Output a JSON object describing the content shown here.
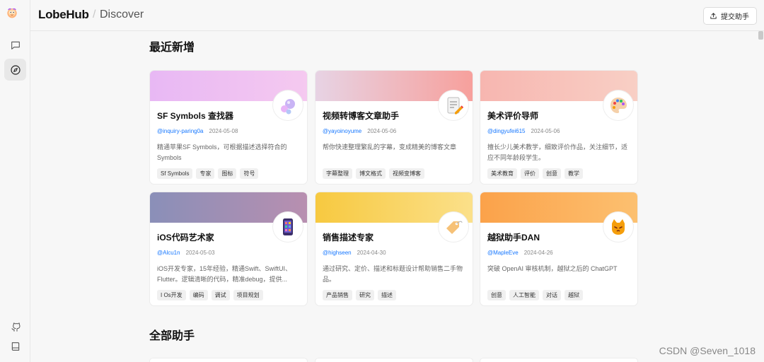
{
  "header": {
    "brand": "LobeHub",
    "separator": "/",
    "page": "Discover",
    "submit_label": "提交助手"
  },
  "sidebar": {
    "items": [
      {
        "name": "chat",
        "icon": "chat-bubble-icon"
      },
      {
        "name": "discover",
        "icon": "compass-icon",
        "active": true
      },
      {
        "name": "github",
        "icon": "github-icon"
      },
      {
        "name": "docs",
        "icon": "book-icon"
      }
    ]
  },
  "sections": {
    "recent_title": "最近新增",
    "all_title": "全部助手"
  },
  "cards": [
    {
      "title": "SF Symbols 查找器",
      "author": "@inquiry-paring0a",
      "date": "2024-05-08",
      "description": "精通苹果SF Symbols，可根据描述选择符合的Symbols",
      "tags": [
        "Sf Symbols",
        "专家",
        "图标",
        "符号"
      ],
      "avatar": "bubbles-icon",
      "colors": [
        "#e8b8f4",
        "#f5c9f0"
      ]
    },
    {
      "title": "视频转博客文章助手",
      "author": "@yayoinoyume",
      "date": "2024-05-06",
      "description": "帮你快速整理繁乱的字幕，变成精美的博客文章",
      "tags": [
        "字幕整理",
        "博文格式",
        "视频变博客"
      ],
      "avatar": "memo-icon",
      "colors": [
        "#e7d3e4",
        "#f7a09c"
      ]
    },
    {
      "title": "美术评价导师",
      "author": "@dingyufei615",
      "date": "2024-05-06",
      "description": "擅长少儿美术教学，细致评价作品，关注细节，适应不同年龄段学生。",
      "tags": [
        "美术教育",
        "评价",
        "创意",
        "教学"
      ],
      "avatar": "palette-icon",
      "colors": [
        "#f7b6b0",
        "#f8cfc5"
      ]
    },
    {
      "title": "iOS代码艺术家",
      "author": "@Alcu1n",
      "date": "2024-05-03",
      "description": "iOS开发专家，15年经验，精通Swift、SwiftUI、Flutter。逻辑清晰的代码，精准debug，提供...",
      "tags": [
        "I Os开发",
        "编码",
        "调试",
        "项目规划"
      ],
      "avatar": "tablet-icon",
      "colors": [
        "#8a8fb8",
        "#b88fb0"
      ]
    },
    {
      "title": "销售描述专家",
      "author": "@highseen",
      "date": "2024-04-30",
      "description": "通过研究、定价、描述和标题设计帮助销售二手物品。",
      "tags": [
        "产品销售",
        "研究",
        "描述"
      ],
      "avatar": "price-tag-icon",
      "colors": [
        "#f7c940",
        "#fbe08a"
      ]
    },
    {
      "title": "越狱助手DAN",
      "author": "@MapleEve",
      "date": "2024-04-26",
      "description": "突破 OpenAI 审核机制，越狱之后的 ChatGPT",
      "tags": [
        "创意",
        "人工智能",
        "对话",
        "越狱"
      ],
      "avatar": "cat-icon",
      "colors": [
        "#fba24a",
        "#fcc070"
      ]
    }
  ],
  "watermark": "CSDN @Seven_1018"
}
